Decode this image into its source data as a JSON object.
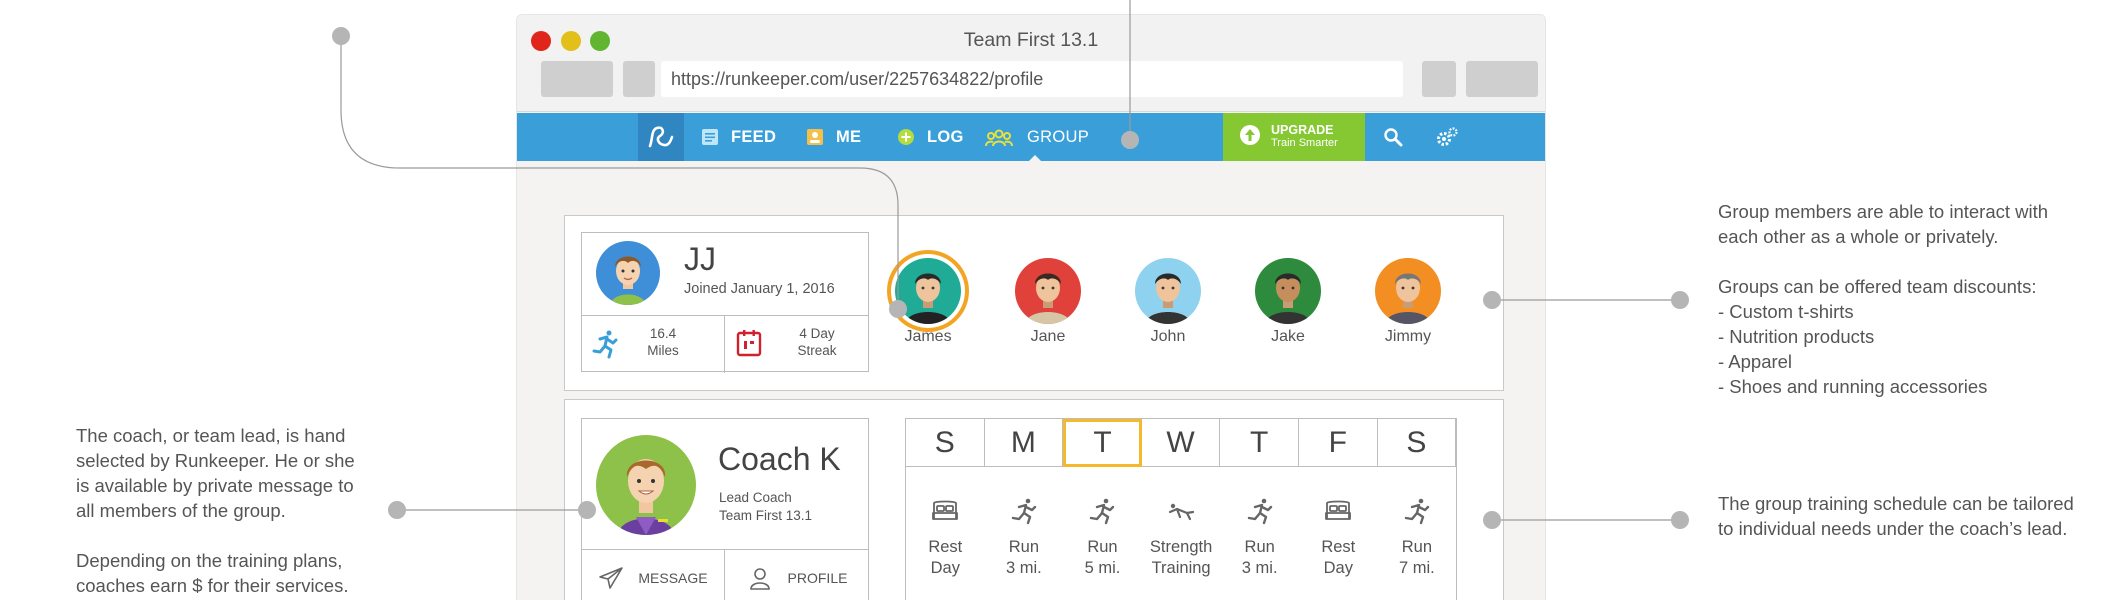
{
  "annotations": {
    "group_members": "Group members are able to interact with\neach other as a whole or privately.\n\nGroups can be offered team discounts:\n- Custom t-shirts\n- Nutrition products\n- Apparel\n- Shoes and running accessories",
    "coach": "The coach, or team lead, is hand\nselected by Runkeeper. He or she\nis available by private message to\nall members of the group.\n\nDepending on the training plans,\ncoaches earn $ for their services.",
    "schedule": "The group training schedule can be tailored\nto individual needs under the coach’s lead."
  },
  "window": {
    "title": "Team First 13.1",
    "url": "https://runkeeper.com/user/2257634822/profile"
  },
  "navbar": {
    "logo_icon": "runkeeper-logo-icon",
    "items": [
      {
        "label": "FEED",
        "icon": "feed-icon"
      },
      {
        "label": "ME",
        "icon": "me-icon"
      },
      {
        "label": "LOG",
        "icon": "log-plus-icon"
      },
      {
        "label": "GROUP",
        "icon": "group-icon"
      }
    ],
    "upgrade": {
      "title": "UPGRADE",
      "subtitle": "Train Smarter"
    },
    "search_icon": "search-icon",
    "settings_icon": "gear-icon",
    "colors": {
      "bar": "#3a9fd9",
      "upgrade": "#86c832"
    }
  },
  "user": {
    "name": "JJ",
    "joined": "Joined January 1, 2016",
    "miles_value": "16.4",
    "miles_label": "Miles",
    "streak_value": "4 Day",
    "streak_label": "Streak"
  },
  "members": [
    {
      "name": "James",
      "color": "#1fab96",
      "selected": true
    },
    {
      "name": "Jane",
      "color": "#e0413a"
    },
    {
      "name": "John",
      "color": "#8fd2ef"
    },
    {
      "name": "Jake",
      "color": "#2e8a3c"
    },
    {
      "name": "Jimmy",
      "color": "#f38e22"
    }
  ],
  "coach": {
    "name": "Coach K",
    "role": "Lead Coach",
    "team": "Team First 13.1",
    "message_label": "MESSAGE",
    "profile_label": "PROFILE"
  },
  "schedule": {
    "days": [
      "S",
      "M",
      "T",
      "W",
      "T",
      "F",
      "S"
    ],
    "today_index": 2,
    "activities": [
      {
        "label": "Rest\nDay",
        "icon": "bed-icon"
      },
      {
        "label": "Run\n3 mi.",
        "icon": "runner-icon"
      },
      {
        "label": "Run\n5 mi.",
        "icon": "runner-icon"
      },
      {
        "label": "Strength\nTraining",
        "icon": "strength-icon"
      },
      {
        "label": "Run\n3 mi.",
        "icon": "runner-icon"
      },
      {
        "label": "Rest\nDay",
        "icon": "bed-icon"
      },
      {
        "label": "Run\n7 mi.",
        "icon": "runner-icon"
      }
    ]
  }
}
